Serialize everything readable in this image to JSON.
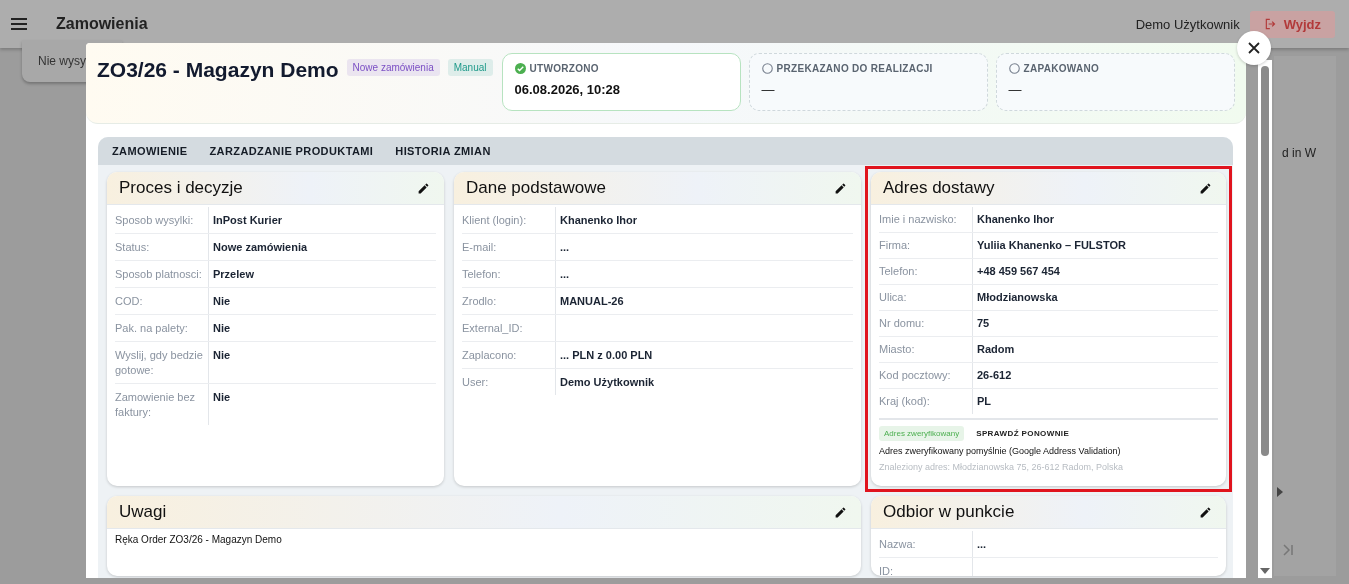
{
  "app_bar": {
    "title": "Zamowienia",
    "user": "Demo Użytkownik",
    "logout": "Wyjdz"
  },
  "background": {
    "notice": "Nie wysy",
    "side_text": "d in W"
  },
  "dialog": {
    "title": "ZO3/26 - Magazyn Demo",
    "badges": [
      {
        "label": "Nowe zamówienia",
        "color": "#7b4fc4"
      },
      {
        "label": "Manual",
        "color": "#1f9a8a"
      }
    ],
    "stages": [
      {
        "label": "UTWORZONO",
        "value": "06.08.2026, 10:28",
        "done": true
      },
      {
        "label": "PRZEKAZANO DO REALIZACJI",
        "value": "—",
        "done": false
      },
      {
        "label": "ZAPAKOWANO",
        "value": "—",
        "done": false
      }
    ],
    "tabs": [
      {
        "label": "ZAMOWIENIE"
      },
      {
        "label": "ZARZADZANIE PRODUKTAMI"
      },
      {
        "label": "HISTORIA ZMIAN"
      }
    ],
    "cards": [
      {
        "title": "Proces i decyzje",
        "highlighted": false,
        "rows": [
          {
            "label": "Sposob wysylki:",
            "value": "InPost Kurier"
          },
          {
            "label": "Status:",
            "value": "Nowe zamówienia"
          },
          {
            "label": "Sposob platnosci:",
            "value": "Przelew"
          },
          {
            "label": "COD:",
            "value": "Nie"
          },
          {
            "label": "Pak. na palety:",
            "value": "Nie"
          },
          {
            "label": "Wyslij, gdy bedzie gotowe:",
            "value": "Nie"
          },
          {
            "label": "Zamowienie bez faktury:",
            "value": "Nie"
          }
        ]
      },
      {
        "title": "Dane podstawowe",
        "highlighted": false,
        "rows": [
          {
            "label": "Klient (login):",
            "value": "Khanenko Ihor"
          },
          {
            "label": "E-mail:",
            "value": "..."
          },
          {
            "label": "Telefon:",
            "value": "..."
          },
          {
            "label": "Zrodlo:",
            "value": "MANUAL-26"
          },
          {
            "label": "External_ID:"
          },
          {
            "label": "Zaplacono:",
            "value": "... PLN z 0.00 PLN"
          },
          {
            "label": "User:",
            "value": "Demo Użytkownik"
          }
        ]
      },
      {
        "title": "Adres dostawy",
        "highlighted": true,
        "rows": [
          {
            "label": "Imie i nazwisko:",
            "value": "Khanenko Ihor"
          },
          {
            "label": "Firma:",
            "value": "Yuliia Khanenko – FULSTOR"
          },
          {
            "label": "Telefon:",
            "value": "+48 459 567 454"
          },
          {
            "label": "Ulica:",
            "value": "Młodzianowska"
          },
          {
            "label": "Nr domu:",
            "value": "75"
          },
          {
            "label": "Miasto:",
            "value": "Radom"
          },
          {
            "label": "Kod pocztowy:",
            "value": "26-612"
          },
          {
            "label": "Kraj (kod):",
            "value": "PL"
          }
        ],
        "verification": {
          "badge": "Adres zweryfikowany",
          "action": "SPRAWDŹ PONOWNIE",
          "message": "Adres zweryfikowany pomyślnie (Google Address Validation)",
          "found": "Znaleziony adres: Młodzianowska 75, 26-612 Radom, Polska"
        }
      }
    ],
    "notes": {
      "title": "Uwagi",
      "text": "Ręka Order ZO3/26 - Magazyn Demo"
    },
    "pickup": {
      "title": "Odbior w punkcie",
      "rows": [
        {
          "label": "Nazwa:",
          "value": "..."
        },
        {
          "label": "ID:"
        }
      ]
    }
  }
}
